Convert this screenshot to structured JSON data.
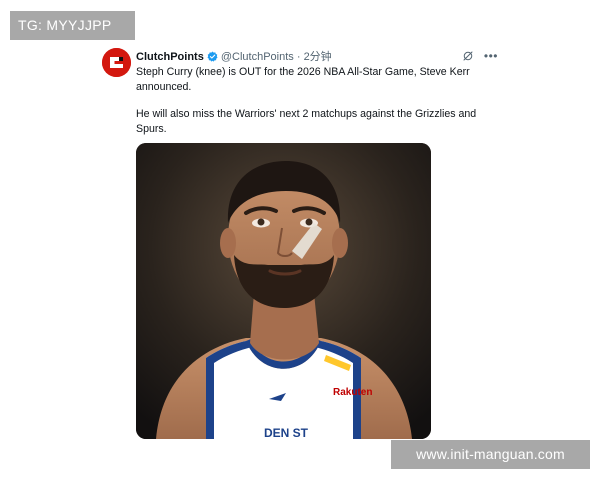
{
  "banner": {
    "text": "TG: MYYJJPP"
  },
  "tweet": {
    "author": "ClutchPoints",
    "handle": "@ClutchPoints",
    "separator": "·",
    "time": "2分钟",
    "paragraph1": "Steph Curry (knee) is OUT for the 2026 NBA All-Star Game, Steve Kerr announced.",
    "paragraph2": "He will also miss the Warriors' next 2 matchups against the Grizzlies and Spurs.",
    "more_icon": "more-horizontal-icon",
    "grok_icon": "grok-icon"
  },
  "media": {
    "jersey_sponsor": "Rakuten",
    "jersey_text": "DEN ST"
  },
  "watermark": {
    "text": "www.init-manguan.com"
  },
  "colors": {
    "avatar_bg": "#d3180f",
    "verified": "#1d9bf0",
    "muted_text": "#536471",
    "overlay_gray": "#a8a8a8"
  }
}
